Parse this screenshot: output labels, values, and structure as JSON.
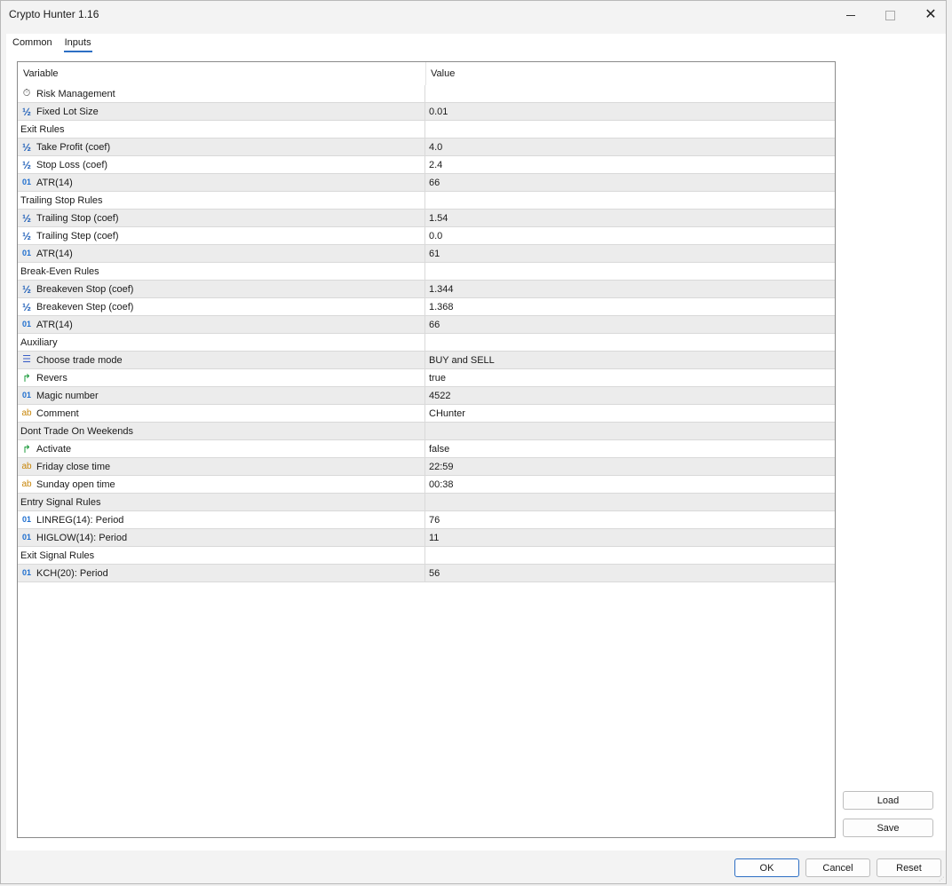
{
  "window": {
    "title": "Crypto Hunter 1.16"
  },
  "tabs": [
    {
      "label": "Common"
    },
    {
      "label": "Inputs"
    }
  ],
  "grid": {
    "col_variable": "Variable",
    "col_value": "Value",
    "rows": [
      {
        "type": "timer",
        "variable": "Risk Management",
        "value": ""
      },
      {
        "type": "frac",
        "variable": "Fixed Lot Size",
        "value": "0.01"
      },
      {
        "type": "group",
        "variable": "Exit Rules",
        "value": ""
      },
      {
        "type": "frac",
        "variable": "Take Profit (coef)",
        "value": "4.0"
      },
      {
        "type": "frac",
        "variable": "Stop Loss (coef)",
        "value": "2.4"
      },
      {
        "type": "int",
        "variable": "ATR(14)",
        "value": "66"
      },
      {
        "type": "group",
        "variable": "Trailing Stop Rules",
        "value": ""
      },
      {
        "type": "frac",
        "variable": "Trailing Stop  (coef)",
        "value": "1.54"
      },
      {
        "type": "frac",
        "variable": "Trailing Step (coef)",
        "value": "0.0"
      },
      {
        "type": "int",
        "variable": "ATR(14)",
        "value": "61"
      },
      {
        "type": "group",
        "variable": "Break-Even Rules",
        "value": ""
      },
      {
        "type": "frac",
        "variable": "Breakeven Stop  (coef)",
        "value": "1.344"
      },
      {
        "type": "frac",
        "variable": "Breakeven Step (coef)",
        "value": "1.368"
      },
      {
        "type": "int",
        "variable": "ATR(14)",
        "value": "66"
      },
      {
        "type": "group",
        "variable": "Auxiliary",
        "value": ""
      },
      {
        "type": "enum",
        "variable": "Choose trade mode",
        "value": "BUY and SELL"
      },
      {
        "type": "bool",
        "variable": "Revers",
        "value": "true"
      },
      {
        "type": "int",
        "variable": "Magic number",
        "value": "4522"
      },
      {
        "type": "str",
        "variable": "Comment",
        "value": "CHunter"
      },
      {
        "type": "group",
        "variable": "Dont Trade On Weekends",
        "value": ""
      },
      {
        "type": "bool",
        "variable": "Activate",
        "value": "false"
      },
      {
        "type": "str",
        "variable": "Friday close time",
        "value": "22:59"
      },
      {
        "type": "str",
        "variable": "Sunday open time",
        "value": "00:38"
      },
      {
        "type": "group",
        "variable": "Entry Signal Rules",
        "value": ""
      },
      {
        "type": "int",
        "variable": "LINREG(14): Period",
        "value": "76"
      },
      {
        "type": "int",
        "variable": "HIGLOW(14): Period",
        "value": "11"
      },
      {
        "type": "group",
        "variable": "Exit Signal Rules",
        "value": ""
      },
      {
        "type": "int",
        "variable": "KCH(20): Period",
        "value": "56"
      }
    ]
  },
  "icons": {
    "frac": "½",
    "int": "01",
    "str": "ab",
    "bool": "↱",
    "enum": "☰",
    "timer": "⏱"
  },
  "buttons": {
    "load": "Load",
    "save": "Save",
    "ok": "OK",
    "cancel": "Cancel",
    "reset": "Reset"
  },
  "colors": {
    "accent": "#2d6fc4",
    "row_alt": "#ececec"
  }
}
